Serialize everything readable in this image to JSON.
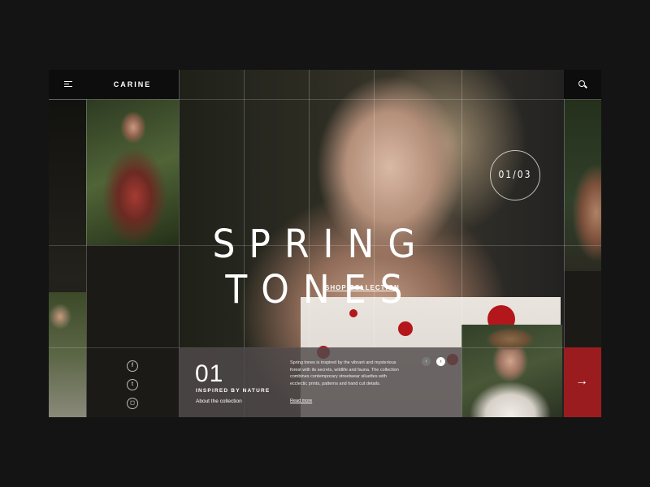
{
  "header": {
    "logo": "CARINE"
  },
  "hero": {
    "counter": "01/03",
    "headline": "SPRING TONES",
    "cta_link": "SHOP COLLECTION"
  },
  "social": {
    "icons": [
      "facebook-icon",
      "twitter-icon",
      "instagram-icon"
    ],
    "glyphs": [
      "f",
      "t",
      "◻"
    ]
  },
  "info": {
    "number": "01",
    "title": "INSPIRED BY NATURE",
    "subtitle": "About the collection",
    "description": "Spring tones is inspired by the vibrant and mysterious forest with its secrets, wildlife and fauna. The collection combines contemporary streetwear siluettes with ecclectic prints, patterns and hand cut details.",
    "read_more": "Read more",
    "prev_glyph": "‹",
    "next_glyph": "›"
  },
  "cta": {
    "glyph": "→",
    "color": "#9b1c1f"
  }
}
